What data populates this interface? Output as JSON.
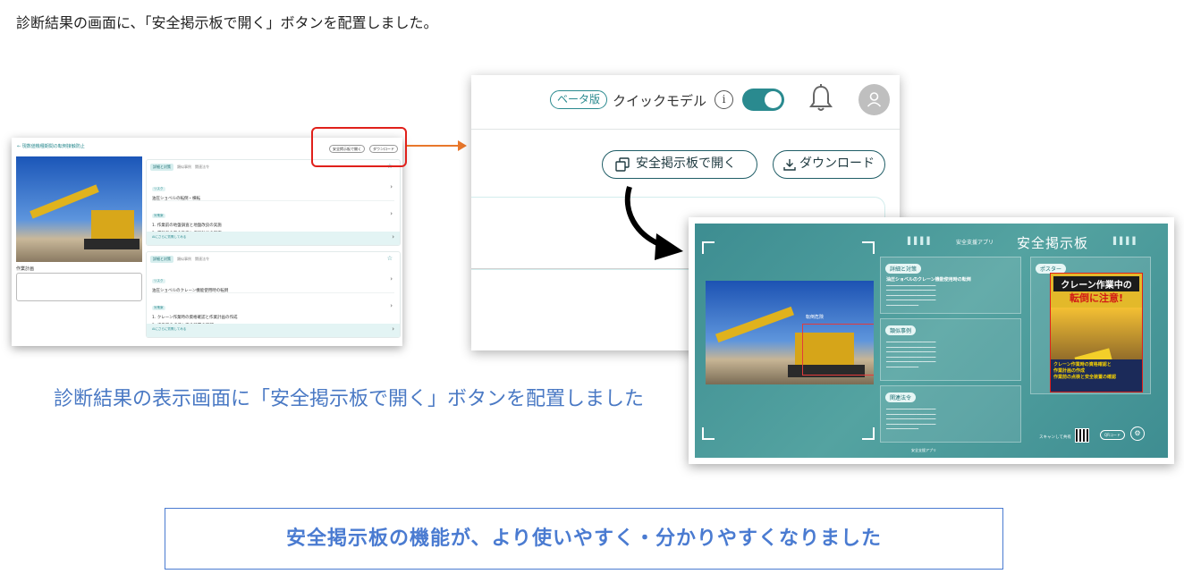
{
  "intro_text": "診断結果の画面に、「安全掲示板で開く」ボタンを配置しました。",
  "left_screen": {
    "back_link": "← 現数値機種期間の転倒接触防止",
    "open_board_button": "安全掲示板で開く",
    "download_button": "ダウンロード",
    "field_label": "作業計画",
    "cards": [
      {
        "tabs": [
          "詳細と対策",
          "類似事例",
          "関連法令"
        ],
        "risk_pill": "リスク",
        "risk_text": "油圧ショベルの転倒・横転",
        "measure_pill": "対策案",
        "measures": [
          "1. 作業前の地盤調査と地盤改良の実施",
          "2. 運転者の安全教育と作業計画の徹底"
        ],
        "footer": "AIにさらに質問してみる"
      },
      {
        "tabs": [
          "詳細と対策",
          "類似事例",
          "関連法令"
        ],
        "risk_pill": "リスク",
        "risk_text": "油圧ショベルのクレーン機能使用時の転倒",
        "measure_pill": "対策案",
        "measures": [
          "1. クレーン作業時の資格確認と作業計画の作成",
          "2. 作業前の点検と安全装置の確認"
        ],
        "footer": "AIにさらに質問してみる"
      }
    ]
  },
  "mid_screen": {
    "beta_badge": "ベータ版",
    "quick_model_label": "クイックモデル",
    "info_icon": "i",
    "open_board_button": "安全掲示板で開く",
    "download_button": "ダウンロード"
  },
  "board": {
    "app_name": "安全支援アプリ",
    "title": "安全掲示板",
    "detect_label": "転倒危険",
    "sections": [
      {
        "head": "詳細と対策",
        "subtitle": "油圧ショベルのクレーン機能使用時の転倒"
      },
      {
        "head": "類似事例",
        "subtitle": ""
      },
      {
        "head": "関連法令",
        "subtitle": ""
      }
    ],
    "poster_head": "ポスター",
    "poster_title_1": "クレーン作業中の",
    "poster_title_2": "転倒に注意!",
    "poster_points": [
      "クレーン作業時の資格確認と",
      "作業計画の作成",
      "作業前の点検と安全装置の確認"
    ],
    "scan_text": "スキャンして共有",
    "qr_button": "QRコード",
    "footer_text": "安全支援アプリ"
  },
  "caption": "診断結果の表示画面に「安全掲示板で開く」ボタンを配置しました",
  "bottom_message": "安全掲示板の機能が、より使いやすく・分かりやすくなりました",
  "colors": {
    "accent_teal": "#2a8a8f",
    "highlight_red": "#e0201b",
    "arrow_orange": "#e8772b",
    "caption_blue": "#4a79c4",
    "box_blue": "#4a7bd1"
  }
}
